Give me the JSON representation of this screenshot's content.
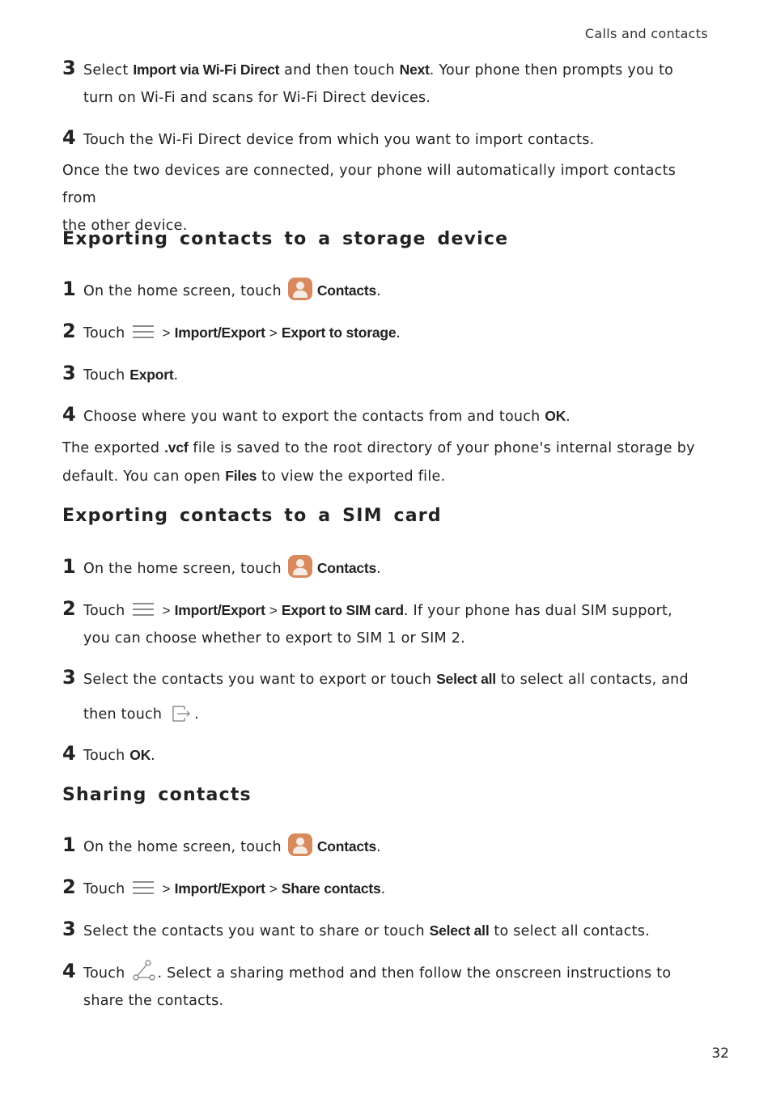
{
  "header": {
    "section": "Calls and contacts"
  },
  "page_number": "32",
  "intro": {
    "step3": {
      "num": "3",
      "t1": "Select ",
      "b1": "Import via Wi-Fi Direct",
      "t2": " and then touch ",
      "b2": "Next",
      "t3": ". Your phone then prompts you to",
      "t4": "turn on Wi-Fi and scans for Wi-Fi Direct devices."
    },
    "step4": {
      "num": "4",
      "t1": "Touch the Wi-Fi Direct device from which you want to import contacts."
    },
    "note": {
      "l1": "Once the two devices are connected, your phone will automatically import contacts from",
      "l2": "the other device."
    }
  },
  "sec_storage": {
    "title": "Exporting contacts to a storage device",
    "step1": {
      "num": "1",
      "t1": "On the home screen, touch",
      "b1": "Contacts",
      "t2": "."
    },
    "step2": {
      "num": "2",
      "t1": "Touch",
      "gt1": "> ",
      "b1": "Import/Export",
      "gt2": " > ",
      "b2": "Export to storage",
      "t2": "."
    },
    "step3": {
      "num": "3",
      "t1": "Touch ",
      "b1": "Export",
      "t2": "."
    },
    "step4": {
      "num": "4",
      "t1": "Choose where you want to export the contacts from and touch ",
      "b1": "OK",
      "t2": "."
    },
    "note": {
      "t1": "The exported ",
      "b1": ".vcf",
      "t2": " file is saved to the root directory of your phone's internal storage by",
      "t3": "default. You can open ",
      "b2": "Files",
      "t4": " to view the exported file."
    }
  },
  "sec_sim": {
    "title": "Exporting contacts to a SIM card",
    "step1": {
      "num": "1",
      "t1": "On the home screen, touch",
      "b1": "Contacts",
      "t2": "."
    },
    "step2": {
      "num": "2",
      "t1": "Touch",
      "gt1": "> ",
      "b1": "Import/Export",
      "gt2": " > ",
      "b2": "Export to SIM card",
      "t2": ". If your phone has dual SIM support,",
      "t3": "you can choose whether to export to SIM 1 or SIM 2."
    },
    "step3": {
      "num": "3",
      "t1": "Select the contacts you want to export or touch ",
      "b1": "Select all",
      "t2": " to select all contacts, and",
      "t3": "then touch",
      "t4": "."
    },
    "step4": {
      "num": "4",
      "t1": "Touch ",
      "b1": "OK",
      "t2": "."
    }
  },
  "sec_share": {
    "title": "Sharing contacts",
    "step1": {
      "num": "1",
      "t1": "On the home screen, touch",
      "b1": "Contacts",
      "t2": "."
    },
    "step2": {
      "num": "2",
      "t1": "Touch",
      "gt1": "> ",
      "b1": "Import/Export",
      "gt2": " > ",
      "b2": "Share contacts",
      "t2": "."
    },
    "step3": {
      "num": "3",
      "t1": "Select the contacts you want to share or touch ",
      "b1": "Select all",
      "t2": " to select all contacts."
    },
    "step4": {
      "num": "4",
      "t1": "Touch",
      "t2": ". Select a sharing method and then follow the onscreen instructions to",
      "t3": "share the contacts."
    }
  }
}
